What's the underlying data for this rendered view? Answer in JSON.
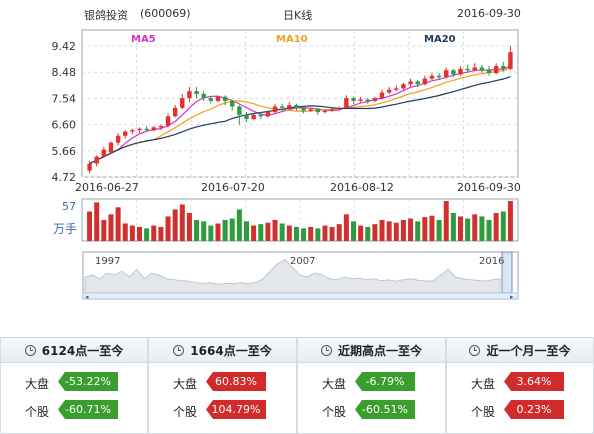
{
  "header": {
    "stock_name": "银鸽投资",
    "stock_code": "(600069)",
    "chart_kind": "日K线",
    "date": "2016-09-30"
  },
  "chart_data": {
    "type": "candlestick",
    "ylim": [
      4.72,
      9.42
    ],
    "y_ticks": [
      "9.42",
      "8.48",
      "7.54",
      "6.60",
      "5.66",
      "4.72"
    ],
    "x_ticks": [
      "2016-06-27",
      "2016-07-20",
      "2016-08-12",
      "2016-09-30"
    ],
    "legend": [
      {
        "name": "MA5",
        "color": "#d633c9"
      },
      {
        "name": "MA10",
        "color": "#f0a020"
      },
      {
        "name": "MA20",
        "color": "#1f3a5f"
      }
    ],
    "volume_label": "57",
    "volume_unit": "万手",
    "candles": [
      [
        4.95,
        5.2,
        4.85,
        5.3
      ],
      [
        5.2,
        5.45,
        5.1,
        5.5
      ],
      [
        5.45,
        5.7,
        5.4,
        5.8
      ],
      [
        5.6,
        5.95,
        5.55,
        6.0
      ],
      [
        5.95,
        6.2,
        5.85,
        6.3
      ],
      [
        6.2,
        6.35,
        6.1,
        6.4
      ],
      [
        6.35,
        6.4,
        6.25,
        6.45
      ],
      [
        6.4,
        6.45,
        6.3,
        6.5
      ],
      [
        6.45,
        6.4,
        6.35,
        6.55
      ],
      [
        6.4,
        6.5,
        6.35,
        6.55
      ],
      [
        6.5,
        6.55,
        6.4,
        6.6
      ],
      [
        6.55,
        6.9,
        6.5,
        7.0
      ],
      [
        6.9,
        7.2,
        6.85,
        7.3
      ],
      [
        7.2,
        7.55,
        7.15,
        7.7
      ],
      [
        7.55,
        7.8,
        7.4,
        7.95
      ],
      [
        7.8,
        7.7,
        7.55,
        7.95
      ],
      [
        7.7,
        7.55,
        7.45,
        7.8
      ],
      [
        7.55,
        7.45,
        7.35,
        7.6
      ],
      [
        7.45,
        7.6,
        7.4,
        7.65
      ],
      [
        7.6,
        7.45,
        7.3,
        7.65
      ],
      [
        7.45,
        7.25,
        7.1,
        7.5
      ],
      [
        7.25,
        6.95,
        6.6,
        7.3
      ],
      [
        6.95,
        6.8,
        6.7,
        7.05
      ],
      [
        6.8,
        6.95,
        6.75,
        7.0
      ],
      [
        6.95,
        6.9,
        6.8,
        7.05
      ],
      [
        6.9,
        7.05,
        6.85,
        7.1
      ],
      [
        7.05,
        7.25,
        7.0,
        7.35
      ],
      [
        7.25,
        7.2,
        7.1,
        7.35
      ],
      [
        7.2,
        7.3,
        7.15,
        7.4
      ],
      [
        7.3,
        7.2,
        7.1,
        7.35
      ],
      [
        7.2,
        7.1,
        7.0,
        7.25
      ],
      [
        7.1,
        7.15,
        7.05,
        7.2
      ],
      [
        7.15,
        7.05,
        6.95,
        7.2
      ],
      [
        7.05,
        7.1,
        7.0,
        7.15
      ],
      [
        7.1,
        7.15,
        7.05,
        7.2
      ],
      [
        7.15,
        7.2,
        7.1,
        7.25
      ],
      [
        7.2,
        7.55,
        7.15,
        7.65
      ],
      [
        7.55,
        7.45,
        7.35,
        7.6
      ],
      [
        7.45,
        7.5,
        7.4,
        7.6
      ],
      [
        7.5,
        7.45,
        7.35,
        7.55
      ],
      [
        7.45,
        7.55,
        7.4,
        7.6
      ],
      [
        7.55,
        7.75,
        7.5,
        7.85
      ],
      [
        7.75,
        7.85,
        7.7,
        7.95
      ],
      [
        7.85,
        7.9,
        7.8,
        8.0
      ],
      [
        7.9,
        8.05,
        7.85,
        8.1
      ],
      [
        8.05,
        8.15,
        7.95,
        8.25
      ],
      [
        8.15,
        8.05,
        7.95,
        8.2
      ],
      [
        8.05,
        8.25,
        8.0,
        8.35
      ],
      [
        8.25,
        8.35,
        8.2,
        8.45
      ],
      [
        8.35,
        8.3,
        8.2,
        8.45
      ],
      [
        8.3,
        8.55,
        8.25,
        8.65
      ],
      [
        8.55,
        8.4,
        8.3,
        8.6
      ],
      [
        8.4,
        8.6,
        8.35,
        8.7
      ],
      [
        8.6,
        8.55,
        8.45,
        8.75
      ],
      [
        8.55,
        8.65,
        8.5,
        8.8
      ],
      [
        8.65,
        8.55,
        8.45,
        8.75
      ],
      [
        8.55,
        8.45,
        8.35,
        8.7
      ],
      [
        8.45,
        8.7,
        8.4,
        8.8
      ],
      [
        8.7,
        8.6,
        8.5,
        8.85
      ],
      [
        8.6,
        9.2,
        8.55,
        9.42
      ]
    ],
    "volumes": [
      42,
      55,
      30,
      38,
      48,
      25,
      22,
      20,
      18,
      22,
      20,
      35,
      45,
      52,
      40,
      30,
      28,
      22,
      25,
      30,
      32,
      45,
      28,
      22,
      24,
      26,
      30,
      25,
      22,
      20,
      18,
      20,
      18,
      22,
      20,
      24,
      38,
      28,
      22,
      20,
      24,
      30,
      28,
      26,
      30,
      32,
      28,
      34,
      36,
      30,
      57,
      40,
      35,
      32,
      38,
      35,
      30,
      40,
      42,
      57
    ],
    "overview": {
      "labels": [
        "1997",
        "2007",
        "2016"
      ]
    }
  },
  "panels": [
    {
      "title": "6124点一至今",
      "dapan_label": "大盘",
      "dapan_value": "-53.22%",
      "dapan_color": "green",
      "gegu_label": "个股",
      "gegu_value": "-60.71%",
      "gegu_color": "green"
    },
    {
      "title": "1664点一至今",
      "dapan_label": "大盘",
      "dapan_value": "60.83%",
      "dapan_color": "red",
      "gegu_label": "个股",
      "gegu_value": "104.79%",
      "gegu_color": "red"
    },
    {
      "title": "近期高点一至今",
      "dapan_label": "大盘",
      "dapan_value": "-6.79%",
      "dapan_color": "green",
      "gegu_label": "个股",
      "gegu_value": "-60.51%",
      "gegu_color": "green"
    },
    {
      "title": "近一个月一至今",
      "dapan_label": "大盘",
      "dapan_value": "3.64%",
      "dapan_color": "red",
      "gegu_label": "个股",
      "gegu_value": "0.23%",
      "gegu_color": "red"
    }
  ]
}
